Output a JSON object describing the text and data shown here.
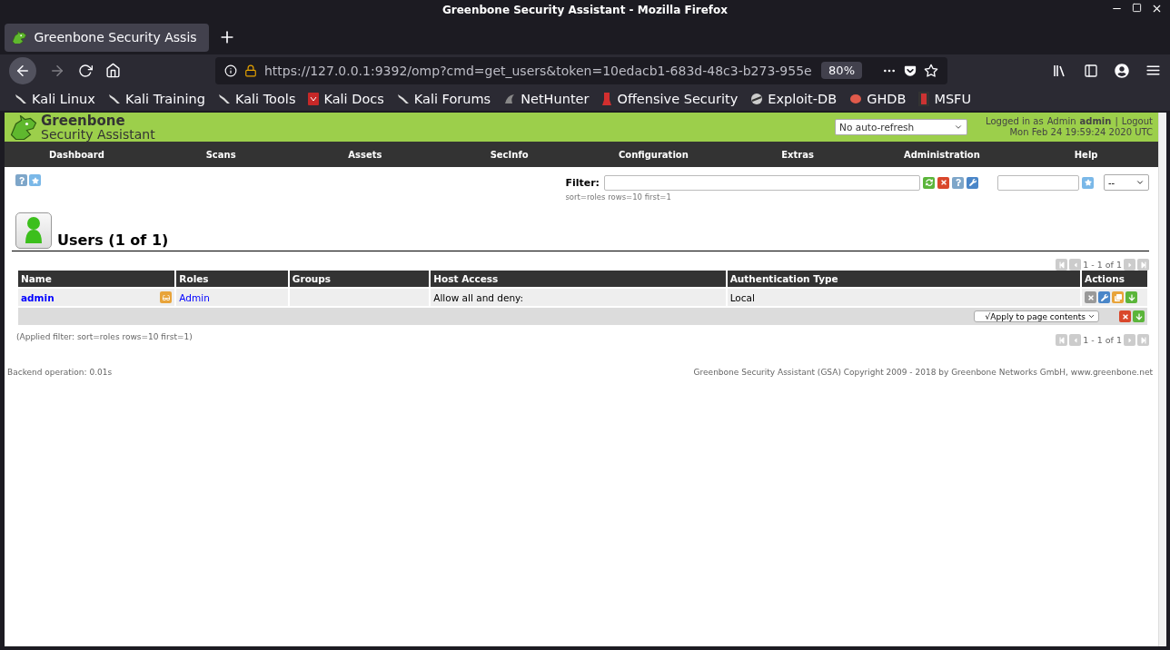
{
  "window": {
    "title": "Greenbone Security Assistant - Mozilla Firefox"
  },
  "browser": {
    "tabs": [
      {
        "label": "Greenbone Security Assis",
        "selected": true
      }
    ],
    "back_disabled": false,
    "forward_disabled": true,
    "url": "https://127.0.0.1:9392/omp?cmd=get_users&token=10edacb1-683d-48c3-b273-955e",
    "zoom": "80%",
    "bookmarks": [
      "Kali Linux",
      "Kali Training",
      "Kali Tools",
      "Kali Docs",
      "Kali Forums",
      "NetHunter",
      "Offensive Security",
      "Exploit-DB",
      "GHDB",
      "MSFU"
    ]
  },
  "header": {
    "logo_line1": "Greenbone",
    "logo_line2": "Security Assistant",
    "refresh": "No auto-refresh",
    "login_prefix": "Logged in as",
    "role": "Admin",
    "user": "admin",
    "separator": "|",
    "logout": "Logout",
    "datetime": "Mon Feb 24 19:59:24 2020 UTC"
  },
  "menu": [
    "Dashboard",
    "Scans",
    "Assets",
    "SecInfo",
    "Configuration",
    "Extras",
    "Administration",
    "Help"
  ],
  "filter": {
    "label": "Filter:",
    "hint": "sort=roles rows=10 first=1",
    "select": "--"
  },
  "title": "Users (1 of 1)",
  "pagination": [
    {
      "text": "1 - 1 of 1",
      "first_disabled": true,
      "prev_disabled": true,
      "next_disabled": true,
      "last_disabled": true
    },
    {
      "text": "1 - 1 of 1",
      "first_disabled": true,
      "prev_disabled": true,
      "next_disabled": true,
      "last_disabled": true
    }
  ],
  "table": {
    "columns": [
      "Name",
      "Roles",
      "Groups",
      "Host Access",
      "Authentication Type",
      "Actions"
    ],
    "rows": [
      {
        "name": "admin",
        "roles": "Admin",
        "host_access": "Allow all and deny:",
        "auth": "Local",
        "actions": [
          {
            "kind": "delete",
            "disabled": true
          },
          {
            "kind": "edit",
            "disabled": false
          },
          {
            "kind": "clone",
            "disabled": false
          },
          {
            "kind": "export",
            "disabled": false
          }
        ]
      }
    ]
  },
  "bulk": {
    "select": "√Apply to page contents",
    "actions": [
      {
        "kind": "delete",
        "disabled": false
      },
      {
        "kind": "export",
        "disabled": false
      }
    ]
  },
  "applied_filter": "(Applied filter: sort=roles rows=10 first=1)",
  "footer": {
    "backend": "Backend operation: 0.01s",
    "copyright": "Greenbone Security Assistant (GSA) Copyright 2009 - 2018 by Greenbone Networks GmbH, www.greenbone.net"
  }
}
